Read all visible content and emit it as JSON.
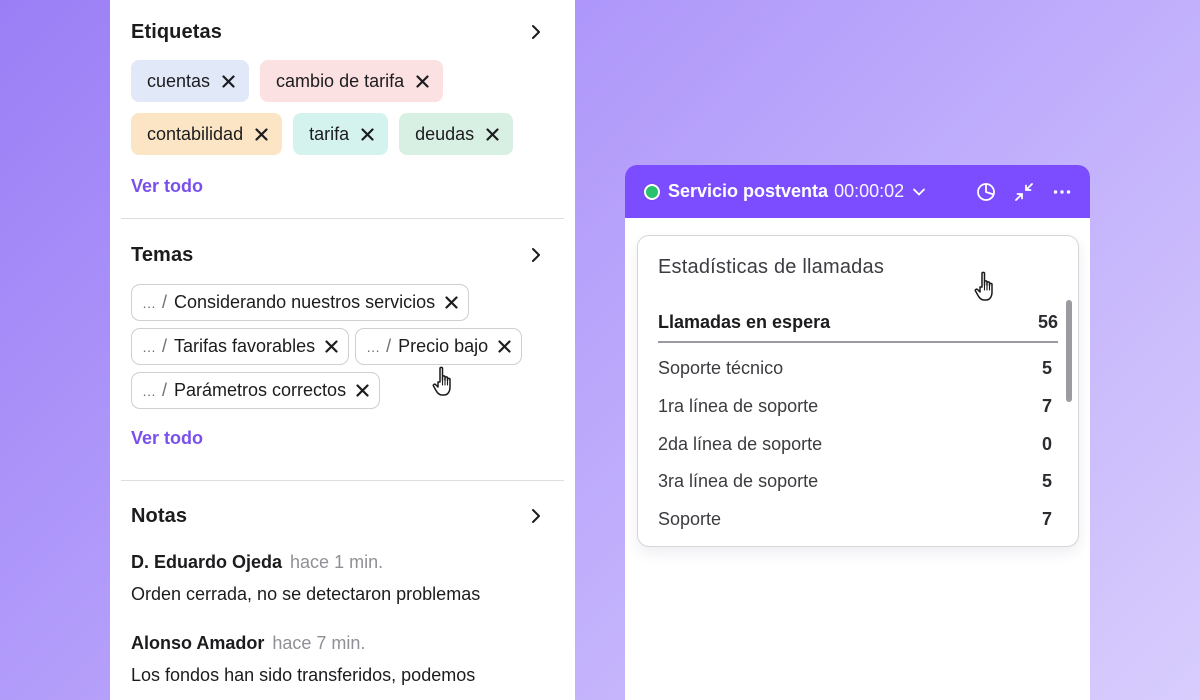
{
  "tags": {
    "title": "Etiquetas",
    "items": [
      {
        "label": "cuentas",
        "color": "#e1e9f8"
      },
      {
        "label": "cambio de tarifa",
        "color": "#fbe1e2"
      },
      {
        "label": "contabilidad",
        "color": "#fbe5c5"
      },
      {
        "label": "tarifa",
        "color": "#d5f3ee"
      },
      {
        "label": "deudas",
        "color": "#d8f0e4"
      }
    ],
    "see_all": "Ver todo"
  },
  "topics": {
    "title": "Temas",
    "ellipsis": "…",
    "separator": "/",
    "items": [
      {
        "label": "Considerando nuestros servicios"
      },
      {
        "label": "Tarifas favorables"
      },
      {
        "label": "Precio bajo"
      },
      {
        "label": "Parámetros correctos"
      }
    ],
    "see_all": "Ver todo"
  },
  "notes": {
    "title": "Notas",
    "items": [
      {
        "author": "D. Eduardo Ojeda",
        "time": "hace 1 min.",
        "text": "Orden cerrada, no se detectaron problemas"
      },
      {
        "author": "Alonso Amador",
        "time": "hace 7 min.",
        "text": "Los fondos han sido transferidos, podemos"
      }
    ]
  },
  "widget": {
    "service_name": "Servicio postventa",
    "timer": "00:00:02",
    "status_color": "#27c26b",
    "header_color": "#7c4dff",
    "icons": [
      "pie-chart-icon",
      "collapse-icon",
      "more-icon"
    ]
  },
  "stats": {
    "title": "Estadísticas de llamadas",
    "total": {
      "label": "Llamadas en espera",
      "value": "56"
    },
    "rows": [
      {
        "label": "Soporte técnico",
        "value": "5"
      },
      {
        "label": "1ra línea de soporte",
        "value": "7"
      },
      {
        "label": "2da línea de soporte",
        "value": "0"
      },
      {
        "label": "3ra línea de soporte",
        "value": "5"
      },
      {
        "label": "Soporte",
        "value": "7"
      }
    ]
  }
}
